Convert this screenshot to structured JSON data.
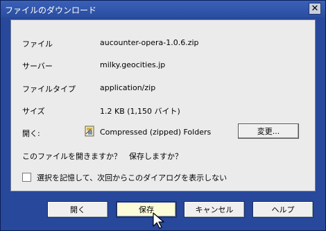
{
  "window": {
    "title": "ファイルのダウンロード",
    "close_label": "✕"
  },
  "details": {
    "file_label": "ファイル",
    "file_value": "aucounter-opera-1.0.6.zip",
    "server_label": "サーバー",
    "server_value": "milky.geocities.jp",
    "type_label": "ファイルタイプ",
    "type_value": "application/zip",
    "size_label": "サイズ",
    "size_value": "1.2 KB (1,150 バイト)",
    "open_label": "開く:",
    "open_value": "Compressed (zipped) Folders",
    "change_label": "変更..."
  },
  "question": "このファイルを開きますか？　保存しますか？",
  "remember": {
    "label": "選択を記憶して、次回からこのダイアログを表示しない",
    "checked": false
  },
  "buttons": {
    "open": "開く",
    "save": "保存",
    "cancel": "キャンセル",
    "help": "ヘルプ"
  },
  "icons": {
    "close": "close-icon",
    "file": "zip-folder-icon",
    "cursor": "cursor-arrow-icon"
  }
}
